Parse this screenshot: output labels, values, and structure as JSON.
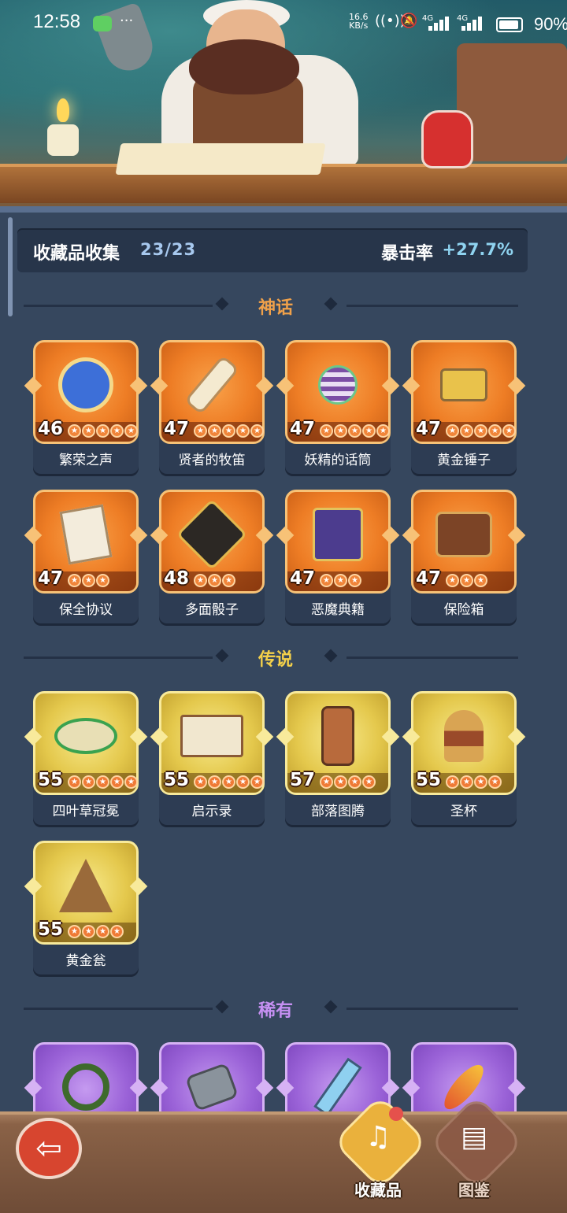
{
  "status_bar": {
    "time": "12:58",
    "net_speed_value": "16.6",
    "net_speed_unit": "KB/s",
    "signal_1": "4G",
    "signal_2": "4G",
    "battery": "90%"
  },
  "header": {
    "collection_label": "收藏品收集",
    "collection_count": "23/23",
    "crit_label": "暴击率",
    "crit_value": "+27.7%"
  },
  "sections": {
    "myth": {
      "title": "神话",
      "items": [
        {
          "name": "繁荣之声",
          "level": "46",
          "icon": "music-orb-icon"
        },
        {
          "name": "贤者的牧笛",
          "level": "47",
          "icon": "flute-icon"
        },
        {
          "name": "妖精的话筒",
          "level": "47",
          "icon": "fairy-microphone-icon"
        },
        {
          "name": "黄金锤子",
          "level": "47",
          "icon": "golden-hammer-icon"
        },
        {
          "name": "保全协议",
          "level": "47",
          "icon": "contract-scroll-icon"
        },
        {
          "name": "多面骰子",
          "level": "48",
          "icon": "polyhedral-dice-icon"
        },
        {
          "name": "恶魔典籍",
          "level": "47",
          "icon": "demon-tome-icon"
        },
        {
          "name": "保险箱",
          "level": "47",
          "icon": "gold-chest-icon"
        }
      ]
    },
    "legend": {
      "title": "传说",
      "items": [
        {
          "name": "四叶草冠冕",
          "level": "55",
          "icon": "clover-crown-icon"
        },
        {
          "name": "启示录",
          "level": "55",
          "icon": "open-book-icon"
        },
        {
          "name": "部落图腾",
          "level": "57",
          "icon": "tribal-totem-icon"
        },
        {
          "name": "圣杯",
          "level": "55",
          "icon": "grail-icon"
        },
        {
          "name": "黄金瓮",
          "level": "55",
          "icon": "golden-urn-icon"
        }
      ]
    },
    "rare": {
      "title": "稀有",
      "items": [
        {
          "icon": "thorn-vine-icon"
        },
        {
          "icon": "stone-axe-icon"
        },
        {
          "icon": "skull-sword-icon"
        },
        {
          "icon": "phoenix-feather-icon"
        }
      ]
    }
  },
  "bottom_nav": {
    "back_icon": "back-arrow-icon",
    "collection_label": "收藏品",
    "codex_label": "图鉴"
  },
  "colors": {
    "myth": "#ee7d25",
    "legend": "#e4c84c",
    "rare": "#9b63d8",
    "background": "#36475e",
    "crit_value": "#8fd3f0"
  }
}
